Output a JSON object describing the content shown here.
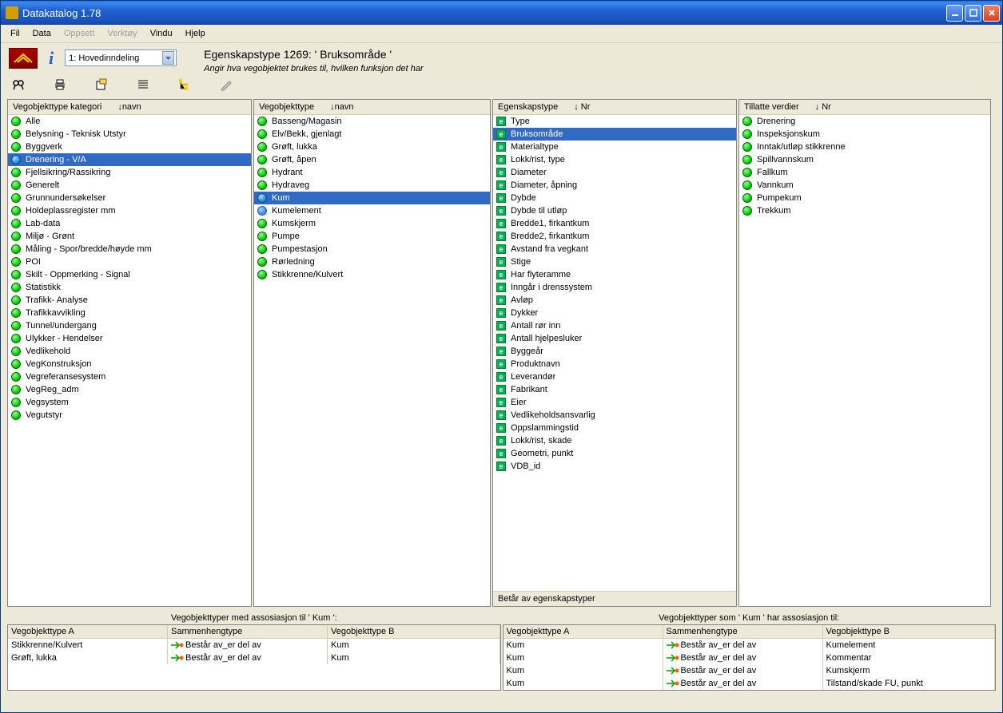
{
  "window": {
    "title": "Datakatalog 1.78"
  },
  "menu": {
    "fil": "Fil",
    "data": "Data",
    "oppsett": "Oppsett",
    "verktoy": "Verktøy",
    "vindu": "Vindu",
    "hjelp": "Hjelp"
  },
  "toolbar": {
    "combo": "1: Hovedinndeling",
    "heading": "Egenskapstype 1269:  ' Bruksområde '",
    "subtitle": "Angir hva vegobjektet brukes til, hvilken funksjon det har"
  },
  "panel_cat": {
    "header1": "Vegobjekttype kategori",
    "header2": "↓navn",
    "items": [
      "Alle",
      "Belysning - Teknisk Utstyr",
      "Byggverk",
      "Drenering - V/A",
      "Fjellsikring/Rassikring",
      "Generelt",
      "Grunnundersøkelser",
      "Holdeplassregister mm",
      "Lab-data",
      "Miljø - Grønt",
      "Måling - Spor/bredde/høyde mm",
      "POI",
      "Skilt - Oppmerking - Signal",
      "Statistikk",
      "Trafikk-  Analyse",
      "Trafikkavvikling",
      "Tunnel/undergang",
      "Ulykker - Hendelser",
      "Vedlikehold",
      "VegKonstruksjon",
      "Vegreferansesystem",
      "VegReg_adm",
      "Vegsystem",
      "Vegutstyr"
    ],
    "selected": 3
  },
  "panel_vot": {
    "header1": "Vegobjekttype",
    "header2": "↓navn",
    "items": [
      "Basseng/Magasin",
      "Elv/Bekk, gjenlagt",
      "Grøft, lukka",
      "Grøft, åpen",
      "Hydrant",
      "Hydraveg",
      "Kum",
      "Kumelement",
      "Kumskjerm",
      "Pumpe",
      "Pumpestasjon",
      "Rørledning",
      "Stikkrenne/Kulvert"
    ],
    "selected": 6,
    "blue_item": 7
  },
  "panel_egt": {
    "header1": "Egenskapstype",
    "header2": "↓ Nr",
    "items": [
      "Type",
      "Bruksområde",
      "Materialtype",
      "Lokk/rist, type",
      "Diameter",
      "Diameter, åpning",
      "Dybde",
      "Dybde til utløp",
      "Bredde1, firkantkum",
      "Bredde2, firkantkum",
      "Avstand fra vegkant",
      "Stige",
      "Har flyteramme",
      "Inngår i drenssystem",
      "Avløp",
      "Dykker",
      "Antall rør inn",
      "Antall hjelpesluker",
      "Byggeår",
      "Produktnavn",
      "Leverandør",
      "Fabrikant",
      "Eier",
      "Vedlikeholdsansvarlig",
      "Oppslammingstid",
      "Lokk/rist, skade",
      "Geometri, punkt",
      "VDB_id"
    ],
    "selected": 1,
    "footer": "Betår av egenskapstyper"
  },
  "panel_tv": {
    "header1": "Tillatte verdier",
    "header2": "↓ Nr",
    "items": [
      "Drenering",
      "Inspeksjonskum",
      "Inntak/utløp stikkrenne",
      "Spillvannskum",
      "Fallkum",
      "Vannkum",
      "Pumpekum",
      "Trekkum"
    ]
  },
  "assoc": {
    "left_title": "Vegobjekttyper med assosiasjon til ' Kum ':",
    "right_title": "Vegobjekttyper som ' Kum ' har assosiasjon til:",
    "col_a": "Vegobjekttype A",
    "col_s": "Sammenhengtype",
    "col_b": "Vegobjekttype B",
    "rel": "Består av_er del av",
    "left_rows": [
      {
        "a": "Stikkrenne/Kulvert",
        "b": "Kum"
      },
      {
        "a": "Grøft, lukka",
        "b": "Kum"
      }
    ],
    "right_rows": [
      {
        "a": "Kum",
        "b": "Kumelement"
      },
      {
        "a": "Kum",
        "b": "Kommentar"
      },
      {
        "a": "Kum",
        "b": "Kumskjerm"
      },
      {
        "a": "Kum",
        "b": "Tilstand/skade FU, punkt"
      }
    ]
  }
}
